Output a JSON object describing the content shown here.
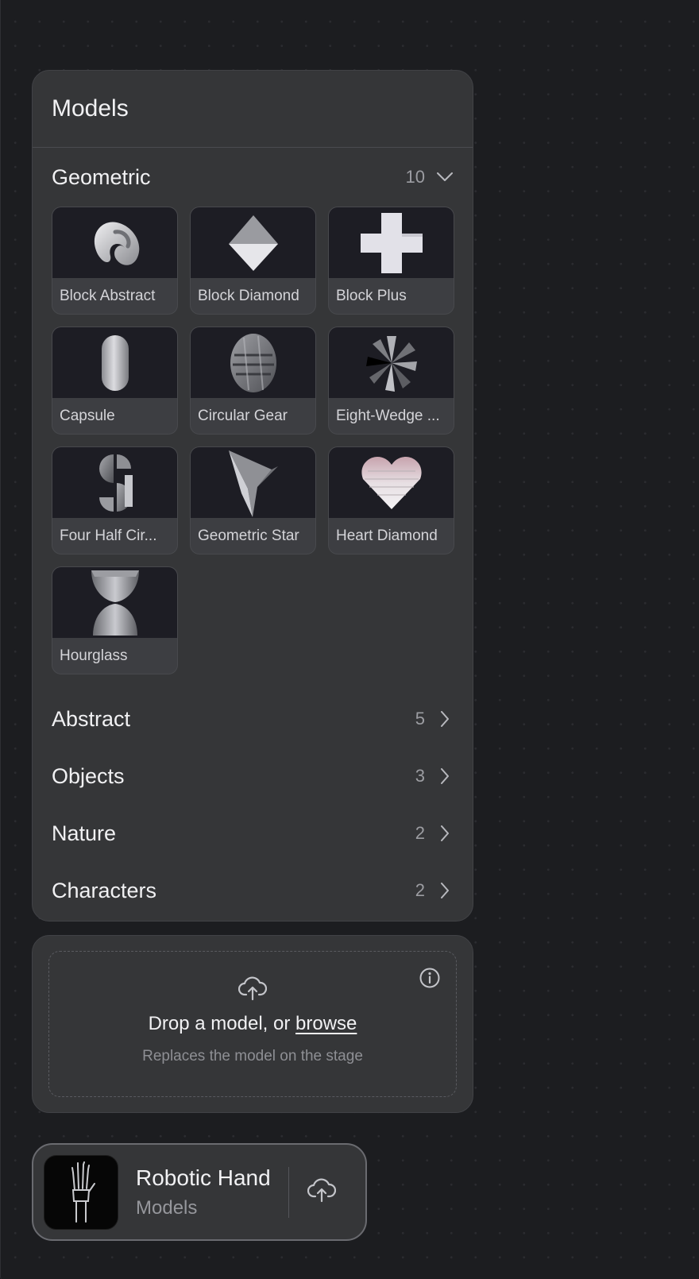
{
  "panel": {
    "title": "Models"
  },
  "geometric": {
    "name": "Geometric",
    "count": "10",
    "items": [
      {
        "label": "Block Abstract"
      },
      {
        "label": "Block Diamond"
      },
      {
        "label": "Block Plus"
      },
      {
        "label": "Capsule"
      },
      {
        "label": "Circular Gear"
      },
      {
        "label": "Eight-Wedge ..."
      },
      {
        "label": "Four Half Cir..."
      },
      {
        "label": "Geometric Star"
      },
      {
        "label": "Heart Diamond"
      },
      {
        "label": "Hourglass"
      }
    ]
  },
  "categories": [
    {
      "name": "Abstract",
      "count": "5"
    },
    {
      "name": "Objects",
      "count": "3"
    },
    {
      "name": "Nature",
      "count": "2"
    },
    {
      "name": "Characters",
      "count": "2"
    }
  ],
  "dropzone": {
    "text": "Drop a model, or ",
    "browse": "browse",
    "subtext": "Replaces the model on the stage"
  },
  "current": {
    "name": "Robotic Hand",
    "category": "Models"
  },
  "icons": {
    "expand": "chevron-down-icon",
    "collapse": "chevron-right-icon",
    "upload": "cloud-upload-icon",
    "info": "info-icon"
  }
}
